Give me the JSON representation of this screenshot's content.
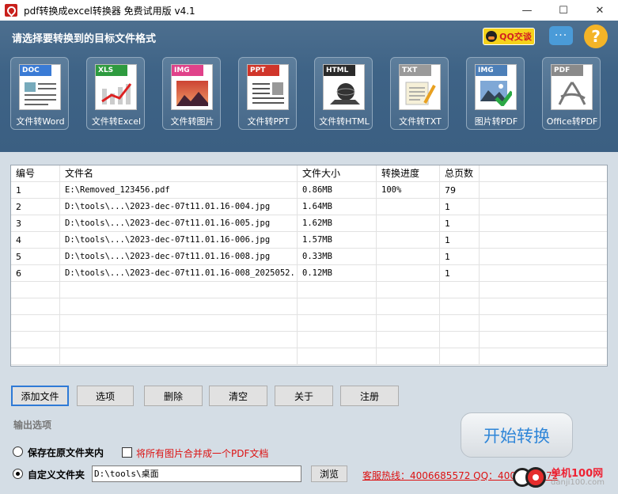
{
  "window": {
    "title": "pdf转换成excel转换器 免费试用版 v4.1",
    "controls": [
      "—",
      "☐",
      "✕"
    ]
  },
  "header": {
    "title": "请选择要转换到的目标文件格式",
    "qq_label": "QQ交谈",
    "chat_glyph": "···",
    "help_glyph": "?"
  },
  "tools": [
    {
      "tag": "DOC",
      "label": "文件转Word",
      "color": "#3a7bd5"
    },
    {
      "tag": "XLS",
      "label": "文件转Excel",
      "color": "#2e9b3f"
    },
    {
      "tag": "IMG",
      "label": "文件转图片",
      "color": "#e0428a"
    },
    {
      "tag": "PPT",
      "label": "文件转PPT",
      "color": "#d0352a"
    },
    {
      "tag": "HTML",
      "label": "文件转HTML",
      "color": "#2a2a2a"
    },
    {
      "tag": "TXT",
      "label": "文件转TXT",
      "color": "#9a9a9a"
    },
    {
      "tag": "IMG",
      "label": "图片转PDF",
      "color": "#4c7fb8"
    },
    {
      "tag": "PDF",
      "label": "Office转PDF",
      "color": "#8a8a8a"
    }
  ],
  "table": {
    "columns": [
      "编号",
      "文件名",
      "文件大小",
      "转换进度",
      "总页数"
    ],
    "rows": [
      [
        "1",
        "E:\\Removed_123456.pdf",
        "0.86MB",
        "100%",
        "79"
      ],
      [
        "2",
        "D:\\tools\\...\\2023-dec-07t11.01.16-004.jpg",
        "1.64MB",
        "",
        "1"
      ],
      [
        "3",
        "D:\\tools\\...\\2023-dec-07t11.01.16-005.jpg",
        "1.62MB",
        "",
        "1"
      ],
      [
        "4",
        "D:\\tools\\...\\2023-dec-07t11.01.16-006.jpg",
        "1.57MB",
        "",
        "1"
      ],
      [
        "5",
        "D:\\tools\\...\\2023-dec-07t11.01.16-008.jpg",
        "0.33MB",
        "",
        "1"
      ],
      [
        "6",
        "D:\\tools\\...\\2023-dec-07t11.01.16-008_2025052...",
        "0.12MB",
        "",
        "1"
      ]
    ]
  },
  "buttons": [
    "添加文件",
    "选项",
    "删除",
    "清空",
    "关于",
    "注册"
  ],
  "output": {
    "title": "输出选项",
    "keep_original_label": "保存在原文件夹内",
    "merge_images_label": "将所有图片合并成一个PDF文档",
    "custom_folder_label": "自定义文件夹",
    "custom_folder_value": "D:\\tools\\桌面",
    "browse_label": "浏览",
    "selected": "custom"
  },
  "start_label": "开始转换",
  "hotline": "客服热线：4006685572 QQ：4006685572",
  "watermark": {
    "line1": "单机100网",
    "line2": "danji100.com"
  }
}
